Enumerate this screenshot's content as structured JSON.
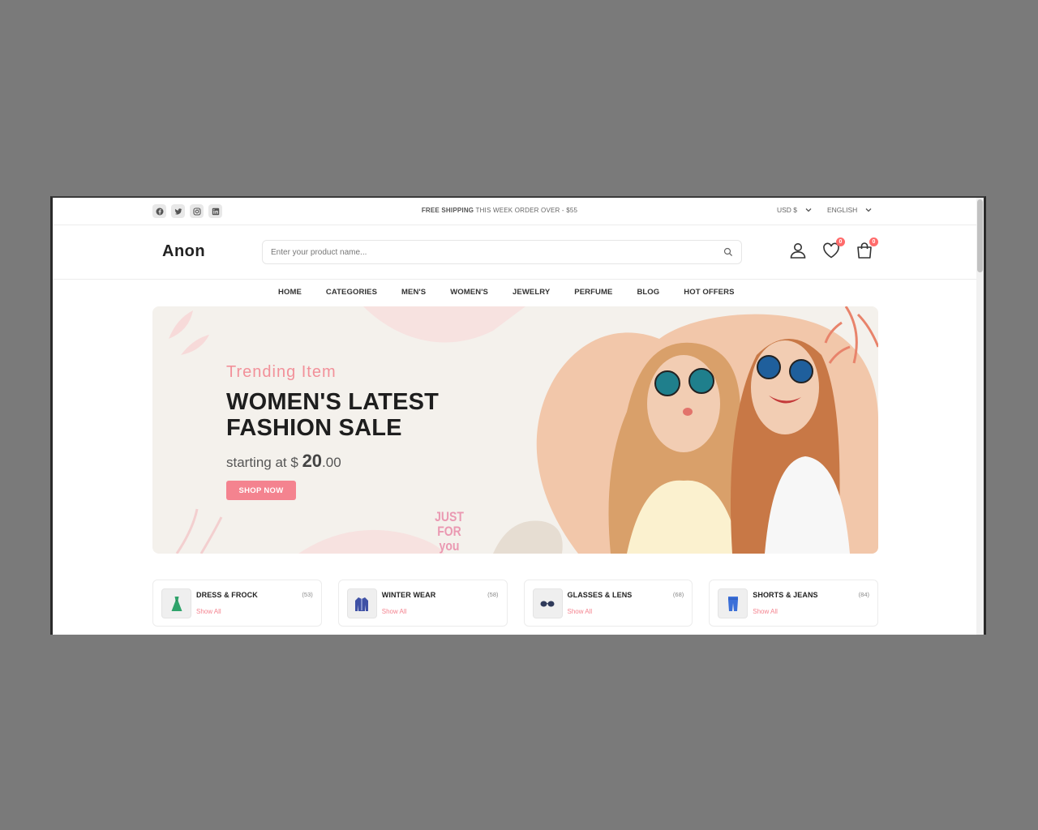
{
  "topbar": {
    "shipping_bold": "FREE SHIPPING",
    "shipping_rest": " THIS WEEK ORDER OVER - $55",
    "currency": "USD $",
    "language": "ENGLISH",
    "socials": [
      "facebook-icon",
      "twitter-icon",
      "instagram-icon",
      "linkedin-icon"
    ]
  },
  "header": {
    "logo": "Anon",
    "search_placeholder": "Enter your product name...",
    "wishlist_count": "0",
    "cart_count": "0"
  },
  "nav": {
    "items": [
      "HOME",
      "CATEGORIES",
      "MEN'S",
      "WOMEN'S",
      "JEWELRY",
      "PERFUME",
      "BLOG",
      "HOT OFFERS"
    ]
  },
  "banner": {
    "subtitle": "Trending Item",
    "title": "WOMEN'S LATEST FASHION SALE",
    "price_prefix": "starting at $ ",
    "price_whole": "20",
    "price_cents": ".00",
    "button": "SHOP NOW",
    "tag": "JUST FOR you"
  },
  "categories": [
    {
      "name": "DRESS & FROCK",
      "count": "(53)",
      "link": "Show All"
    },
    {
      "name": "WINTER WEAR",
      "count": "(58)",
      "link": "Show All"
    },
    {
      "name": "GLASSES & LENS",
      "count": "(68)",
      "link": "Show All"
    },
    {
      "name": "SHORTS & JEANS",
      "count": "(84)",
      "link": "Show All"
    }
  ],
  "colors": {
    "accent": "#f4838f",
    "badge": "#ff6b6b",
    "banner_bg": "#f4f1ec"
  }
}
